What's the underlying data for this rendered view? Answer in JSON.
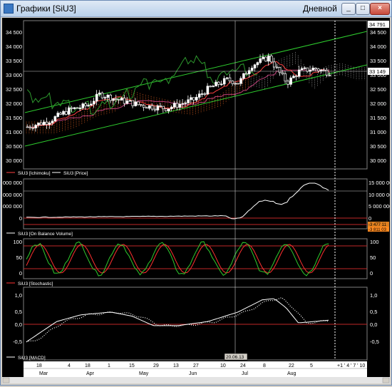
{
  "window": {
    "title": "Графики [SiU3]",
    "period": "Дневной",
    "controls": {
      "minimize": "_",
      "maximize": "□",
      "close": "×"
    }
  },
  "panes": {
    "price": {
      "y_ticks_left": [
        "34 500",
        "34 000",
        "33 500",
        "33 000",
        "32 500",
        "32 000",
        "31 500",
        "31 000",
        "30 500",
        "30 000"
      ],
      "y_ticks_right": [
        "34 500",
        "34 000",
        "33 500",
        "33 000",
        "32 500",
        "32 000",
        "31 500",
        "31 000",
        "30 500",
        "30 000"
      ],
      "price_label_top": "34 791",
      "price_label_cursor": "33 149",
      "legend": [
        "SiU3 [Ichimoku]",
        "SiU3 [Price]"
      ]
    },
    "obv": {
      "y_ticks_left": [
        "000 000",
        "000 000",
        "000 000",
        "0"
      ],
      "y_ticks_right": [
        "15 000 000",
        "10 000 000",
        "5 000 000",
        "0"
      ],
      "value_badges": [
        "-3 477 11",
        "-3 811 03"
      ],
      "legend": [
        "SiU3 [On Balance Volume]"
      ]
    },
    "stochastic": {
      "y_ticks_left": [
        "100",
        "50",
        "0"
      ],
      "y_ticks_right": [
        "100",
        "50",
        "0"
      ],
      "legend": [
        "SiU3 [Stochastic]"
      ]
    },
    "macd": {
      "y_ticks_left": [
        "1,0",
        "0,5",
        "0,0",
        "-0,5"
      ],
      "y_ticks_right": [
        "1,0",
        "0,5",
        "0,0",
        "-0,5"
      ],
      "legend": [
        "SiU3 [MACD]"
      ]
    }
  },
  "cursor_date": "20.06.13",
  "xaxis": {
    "days": [
      "18",
      "4",
      "18",
      "1",
      "15",
      "29",
      "13",
      "27",
      "10",
      "24",
      "8",
      "22",
      "5"
    ],
    "months": [
      "Mar",
      "Apr",
      "May",
      "Jun",
      "Jul",
      "Aug"
    ],
    "extra": "+1 ' 4 ' 7 ' 10"
  },
  "colors": {
    "background": "#000000",
    "candle_bull": "#ffffff",
    "channel": "#2ecc2e",
    "tenkan": "#ff4040",
    "kijun": "#c0407a",
    "chikou": "#2e9a2e",
    "cloud": "#e06020",
    "obv_line": "#ffffff",
    "stoch_k": "#2ecc2e",
    "stoch_d": "#ff3030",
    "level": "#c02828"
  }
}
